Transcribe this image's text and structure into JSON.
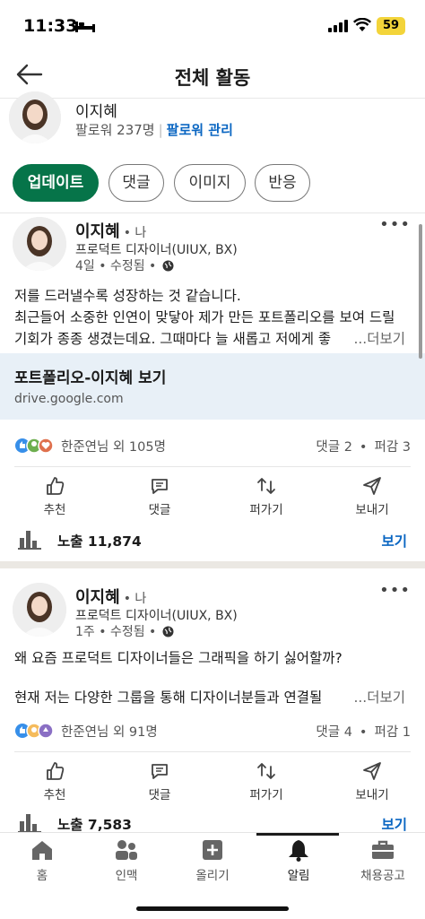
{
  "status_bar": {
    "time": "11:33",
    "battery": "59"
  },
  "header": {
    "title": "전체 활동"
  },
  "profile": {
    "name": "이지혜",
    "followers": "팔로워 237명",
    "manage_link": "팔로워 관리"
  },
  "filters": [
    {
      "label": "업데이트",
      "active": true
    },
    {
      "label": "댓글",
      "active": false
    },
    {
      "label": "이미지",
      "active": false
    },
    {
      "label": "반응",
      "active": false
    }
  ],
  "posts": [
    {
      "author": "이지혜",
      "degree": "• 나",
      "headline": "프로덕트 디자이너(UIUX, BX)",
      "meta": "4일 • 수정됨 •",
      "more": "•••",
      "text_lines": [
        "저를 드러낼수록 성장하는 것 같습니다.",
        "최근들어 소중한 인연이 맞닿아 제가 만든 포트폴리오를 보여 드릴",
        "기회가 종종 생겼는데요. 그때마다 늘 새롭고 저에게 좋"
      ],
      "see_more": "...더보기",
      "link_card": {
        "title": "포트폴리오-이지혜 보기",
        "url": "drive.google.com"
      },
      "reactions": "한준연님 외 105명",
      "comments": "댓글 2",
      "reposts": "퍼감 3",
      "impressions": "노출 11,874",
      "view_label": "보기"
    },
    {
      "author": "이지혜",
      "degree": "• 나",
      "headline": "프로덕트 디자이너(UIUX, BX)",
      "meta": "1주 • 수정됨 •",
      "more": "•••",
      "text_lines": [
        "왜 요즘 프로덕트 디자이너들은 그래픽을 하기 싫어할까?",
        "",
        "현재 저는 다양한 그룹을 통해 디자이너분들과 연결될"
      ],
      "see_more": "...더보기",
      "reactions": "한준연님 외 91명",
      "comments": "댓글 4",
      "reposts": "퍼감 1",
      "impressions": "노출 7,583",
      "view_label": "보기"
    }
  ],
  "actions": [
    "추천",
    "댓글",
    "퍼가기",
    "보내기"
  ],
  "bottom_nav": [
    {
      "label": "홈",
      "icon": "home-icon"
    },
    {
      "label": "인맥",
      "icon": "network-icon"
    },
    {
      "label": "올리기",
      "icon": "post-icon"
    },
    {
      "label": "알림",
      "icon": "bell-icon",
      "active": true
    },
    {
      "label": "채용공고",
      "icon": "briefcase-icon"
    }
  ],
  "colors": {
    "accent_green": "#067449",
    "link_blue": "#0a66c2",
    "card_bg": "#e8f0f7"
  }
}
